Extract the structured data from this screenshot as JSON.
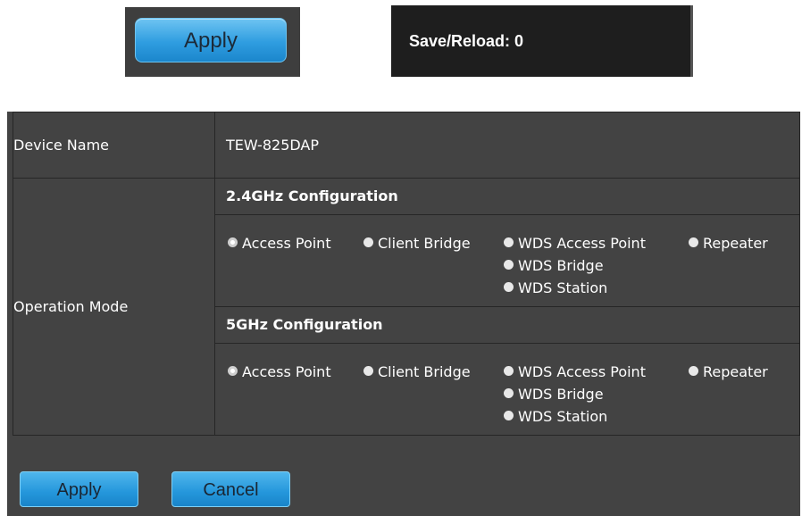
{
  "top": {
    "apply_label": "Apply",
    "save_reload": "Save/Reload: 0"
  },
  "device": {
    "label": "Device Name",
    "value": "TEW-825DAP"
  },
  "operation": {
    "label": "Operation Mode",
    "band24": {
      "header": "2.4GHz Configuration",
      "options": [
        "Access Point",
        "Client Bridge",
        "WDS Access Point",
        "Repeater",
        "WDS Bridge",
        "WDS Station"
      ],
      "selected": "Access Point"
    },
    "band5": {
      "header": "5GHz Configuration",
      "options": [
        "Access Point",
        "Client Bridge",
        "WDS Access Point",
        "Repeater",
        "WDS Bridge",
        "WDS Station"
      ],
      "selected": "Access Point"
    }
  },
  "buttons": {
    "apply": "Apply",
    "cancel": "Cancel"
  },
  "colors": {
    "panel_bg": "#434343",
    "button_blue": "#2496db",
    "border": "#262626"
  }
}
